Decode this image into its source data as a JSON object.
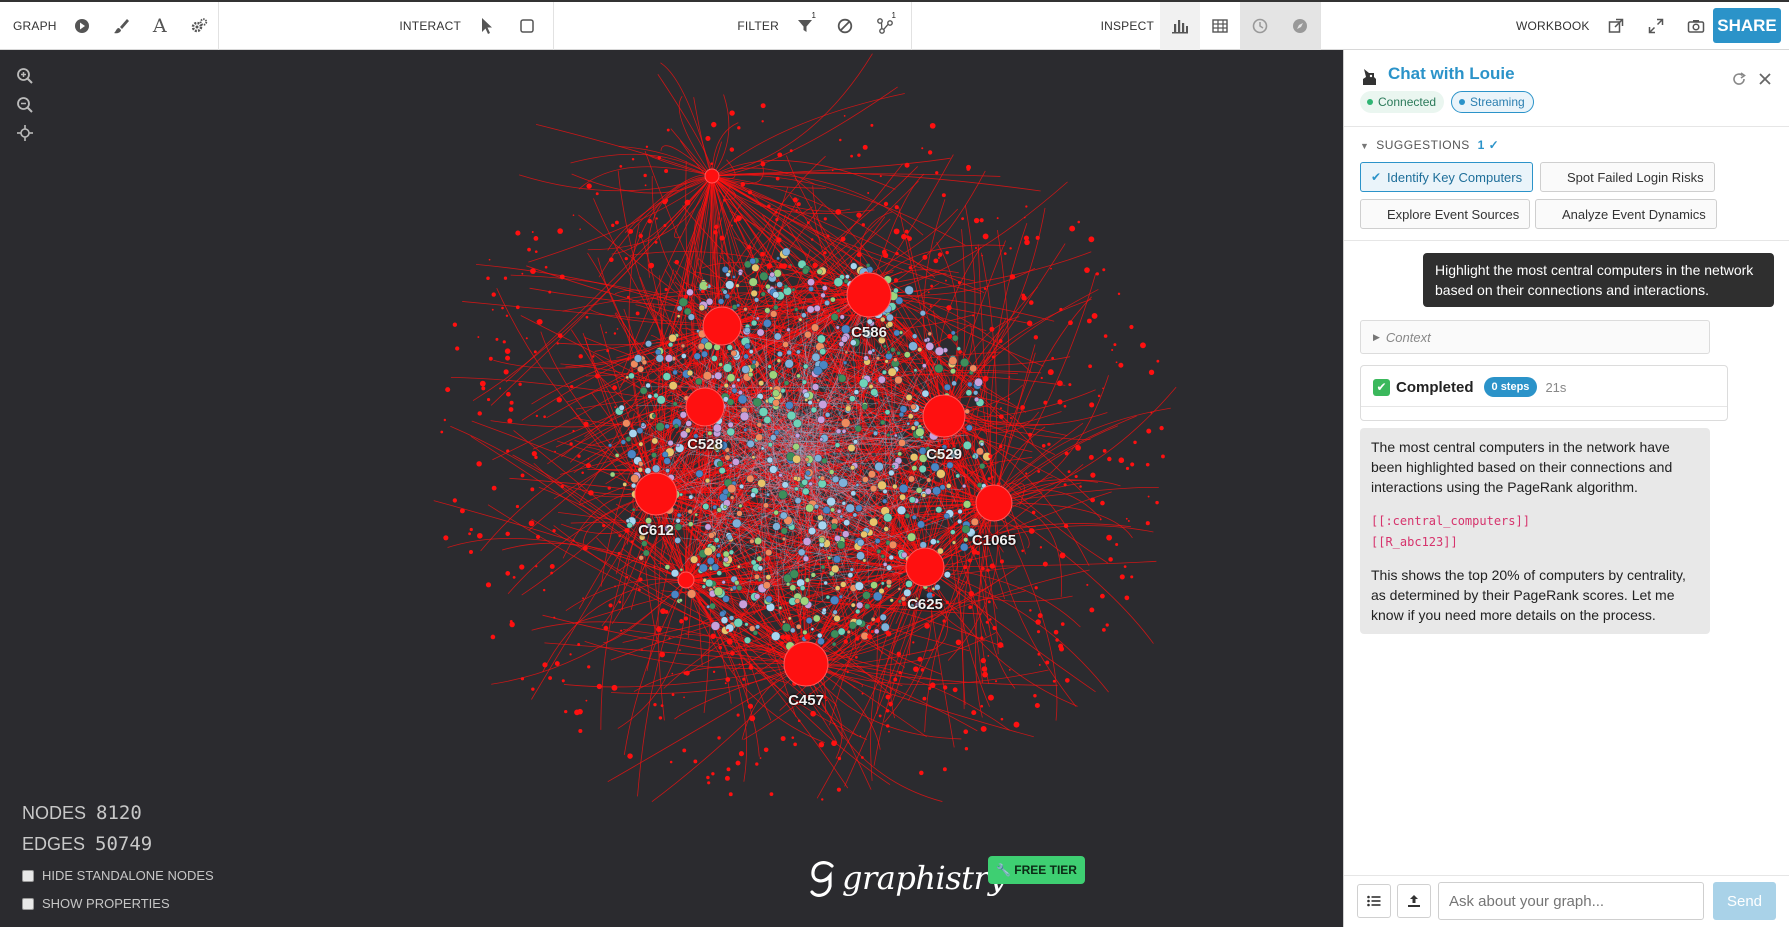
{
  "toolbar": {
    "graph_label": "GRAPH",
    "interact_label": "INTERACT",
    "filter_label": "FILTER",
    "filter_count": "1",
    "cluster_count": "1",
    "inspect_label": "INSPECT",
    "workbook_label": "WORKBOOK",
    "share_label": "SHARE"
  },
  "canvas": {
    "nodes_label": "NODES",
    "nodes_value": "8120",
    "edges_label": "EDGES",
    "edges_value": "50749",
    "hide_standalone_label": "HIDE STANDALONE NODES",
    "show_properties_label": "SHOW PROPERTIES",
    "logo_text": "graphistry",
    "free_tier_label": "FREE TIER",
    "node_labels": [
      "C586",
      "C528",
      "C529",
      "C612",
      "C1065",
      "C625",
      "C457"
    ],
    "colors": {
      "background": "#2b2b2f",
      "highlight": "#ff1010"
    }
  },
  "panel": {
    "title": "Chat with Louie",
    "status_connected": "Connected",
    "status_streaming": "Streaming",
    "suggestions_label": "SUGGESTIONS",
    "suggestions_count": "1 ✓",
    "suggestions": [
      "Identify Key Computers",
      "Spot Failed Login Risks",
      "Explore Event Sources",
      "Analyze Event Dynamics"
    ],
    "user_message": "Highlight the most central computers in the network based on their connections and interactions.",
    "context_label": "Context",
    "completed_label": "Completed",
    "steps_badge": "0 steps",
    "elapsed": "21s",
    "assistant_p1": "The most central computers in the network have been highlighted based on their connections and interactions using the PageRank algorithm.",
    "assistant_code1": "[[:central_computers]]",
    "assistant_code2": "[[R_abc123]]",
    "assistant_p2": "This shows the top 20% of computers by centrality, as determined by their PageRank scores. Let me know if you need more details on the process.",
    "input_placeholder": "Ask about your graph...",
    "send_label": "Send"
  }
}
